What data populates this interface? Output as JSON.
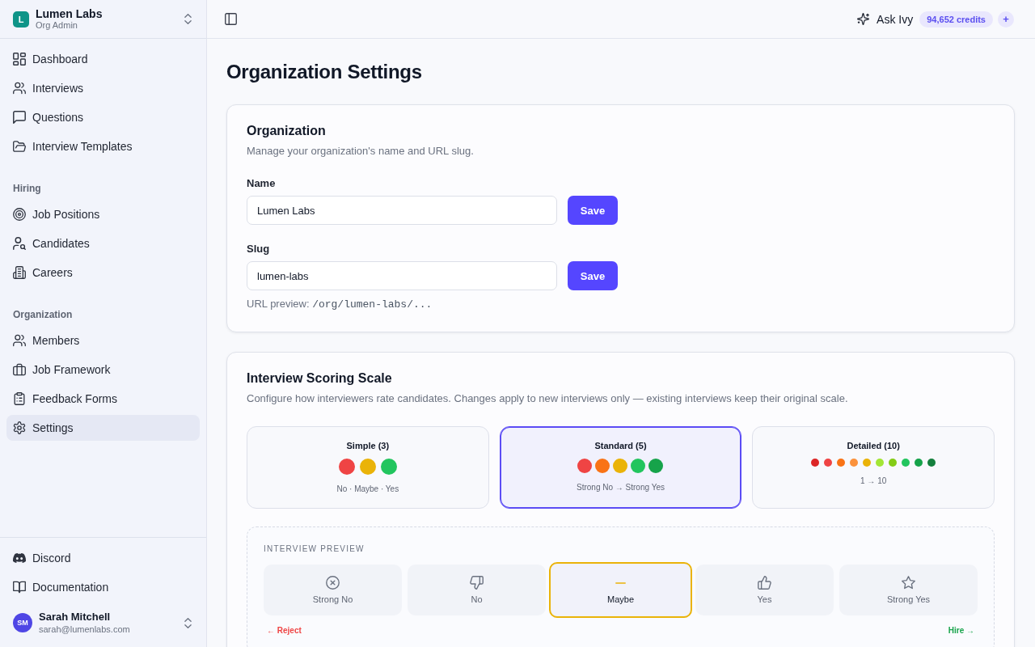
{
  "workspace": {
    "logo": "L",
    "name": "Lumen Labs",
    "role": "Org Admin"
  },
  "nav_sections": [
    {
      "items": [
        {
          "label": "Dashboard",
          "selected": false
        },
        {
          "label": "Interviews",
          "selected": false
        },
        {
          "label": "Questions",
          "selected": false
        },
        {
          "label": "Interview Templates",
          "selected": false
        }
      ]
    },
    {
      "heading": "Hiring",
      "items": [
        {
          "label": "Job Positions",
          "selected": false
        },
        {
          "label": "Candidates",
          "selected": false
        },
        {
          "label": "Careers",
          "selected": false
        }
      ]
    },
    {
      "heading": "Organization",
      "items": [
        {
          "label": "Members",
          "selected": false
        },
        {
          "label": "Job Framework",
          "selected": false
        },
        {
          "label": "Feedback Forms",
          "selected": false
        },
        {
          "label": "Settings",
          "selected": true
        }
      ]
    }
  ],
  "footer_links": [
    {
      "label": "Discord"
    },
    {
      "label": "Documentation"
    }
  ],
  "user": {
    "initials": "SM",
    "name": "Sarah Mitchell",
    "email": "sarah@lumenlabs.com"
  },
  "topbar": {
    "assistant": "Ask Ivy",
    "credits": "94,652 credits",
    "add_button": "+"
  },
  "page_title": "Organization Settings",
  "organization": {
    "title": "Organization",
    "description": "Manage your organization's name and URL slug.",
    "fields": [
      {
        "label": "Name",
        "value": "Lumen Labs",
        "button": "Save"
      },
      {
        "label": "Slug",
        "value": "lumen-labs",
        "button": "Save"
      }
    ],
    "url_preview": {
      "label": "URL preview:",
      "path": "/org/lumen-labs/..."
    }
  },
  "scoring": {
    "title": "Interview Scoring Scale",
    "description": "Configure how interviewers rate candidates. Changes apply to new interviews only — existing interviews keep their original scale.",
    "scales": [
      {
        "title": "Simple (3)",
        "caption": "No · Maybe · Yes",
        "selected": false,
        "dots": [
          {
            "color": "#ef4444"
          },
          {
            "color": "#eab308"
          },
          {
            "color": "#22c55e"
          }
        ]
      },
      {
        "title": "Standard (5)",
        "caption": "Strong No → Strong Yes",
        "selected": true,
        "dots": [
          {
            "color": "#ef4444"
          },
          {
            "color": "#f97316"
          },
          {
            "color": "#eab308"
          },
          {
            "color": "#22c55e"
          },
          {
            "color": "#16a34a"
          }
        ]
      },
      {
        "title": "Detailed (10)",
        "caption": "1 → 10",
        "selected": false,
        "dots": [
          {
            "color": "#dc2626"
          },
          {
            "color": "#ef4444"
          },
          {
            "color": "#f97316"
          },
          {
            "color": "#fb923c"
          },
          {
            "color": "#eab308"
          },
          {
            "color": "#a3e635"
          },
          {
            "color": "#84cc16"
          },
          {
            "color": "#22c55e"
          },
          {
            "color": "#16a34a"
          },
          {
            "color": "#15803d"
          }
        ]
      }
    ],
    "preview": {
      "heading": "INTERVIEW PREVIEW",
      "options": [
        {
          "label": "Strong No",
          "selected": false
        },
        {
          "label": "No",
          "selected": false
        },
        {
          "label": "Maybe",
          "selected": true
        },
        {
          "label": "Yes",
          "selected": false
        },
        {
          "label": "Strong Yes",
          "selected": false
        }
      ],
      "reject": "← Reject",
      "hire": "Hire →"
    }
  }
}
